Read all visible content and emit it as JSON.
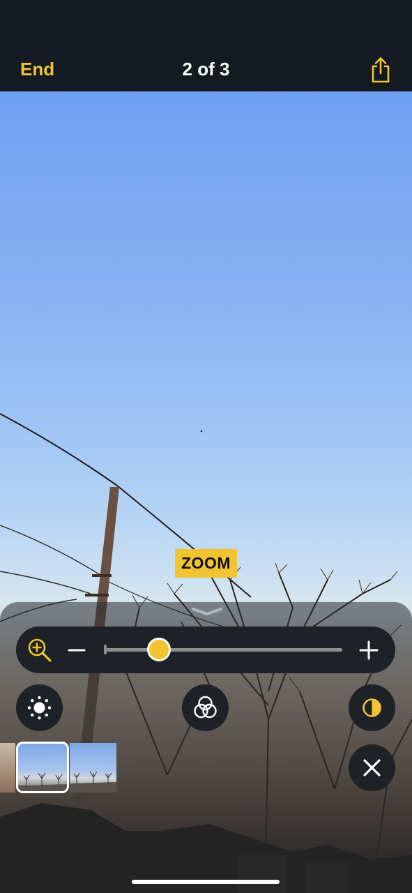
{
  "header": {
    "end_label": "End",
    "title": "2 of 3"
  },
  "overlay": {
    "mode_label": "ZOOM"
  },
  "zoom_control": {
    "level": 0.23
  },
  "icons": {
    "share": "share-icon",
    "zoom": "zoom-in-icon",
    "minus": "minus-icon",
    "plus": "plus-icon",
    "brightness": "brightness-icon",
    "filters": "filters-icon",
    "contrast": "contrast-icon",
    "close": "close-icon"
  },
  "thumbnails": [
    {
      "selected": false
    },
    {
      "selected": true
    },
    {
      "selected": false
    }
  ],
  "colors": {
    "accent": "#f2c432",
    "bar": "#131a22",
    "control_bg": "#1e2226"
  }
}
